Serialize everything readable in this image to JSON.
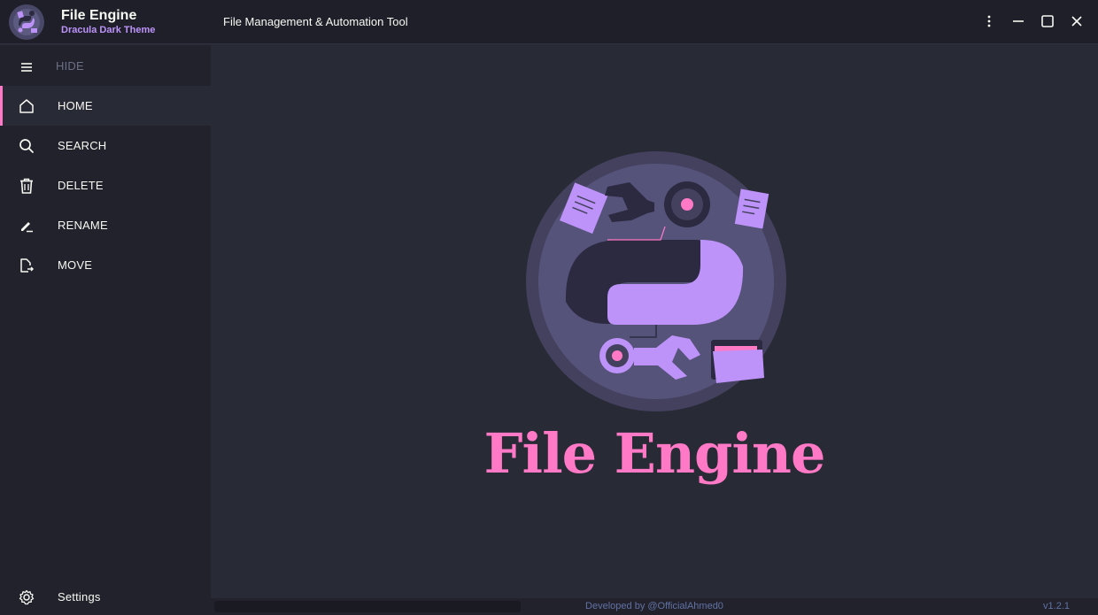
{
  "window": {
    "title": "File Engine",
    "subtitle": "Dracula Dark Theme",
    "description": "File Management & Automation Tool",
    "controls": [
      "more-icon",
      "minimize-icon",
      "maximize-icon",
      "close-icon"
    ]
  },
  "sidebar": {
    "toggle": {
      "label": "HIDE",
      "icon": "menu-icon"
    },
    "items": [
      {
        "label": "HOME",
        "icon": "home-icon",
        "active": true
      },
      {
        "label": "SEARCH",
        "icon": "search-icon",
        "active": false
      },
      {
        "label": "DELETE",
        "icon": "trash-icon",
        "active": false
      },
      {
        "label": "RENAME",
        "icon": "rename-icon",
        "active": false
      },
      {
        "label": "MOVE",
        "icon": "move-file-icon",
        "active": false
      }
    ],
    "settings": {
      "label": "Settings",
      "icon": "gear-icon"
    }
  },
  "main": {
    "hero_title": "File Engine"
  },
  "footer": {
    "credit": "Developed by @OfficialAhmed0",
    "version": "v1.2.1"
  },
  "colors": {
    "background": "#282a36",
    "sidebar": "#21222c",
    "titlebar": "#1e1f29",
    "accent_pink": "#ff79c6",
    "accent_purple": "#bd93f9",
    "comment": "#6272a4",
    "foreground": "#f8f8f2"
  }
}
